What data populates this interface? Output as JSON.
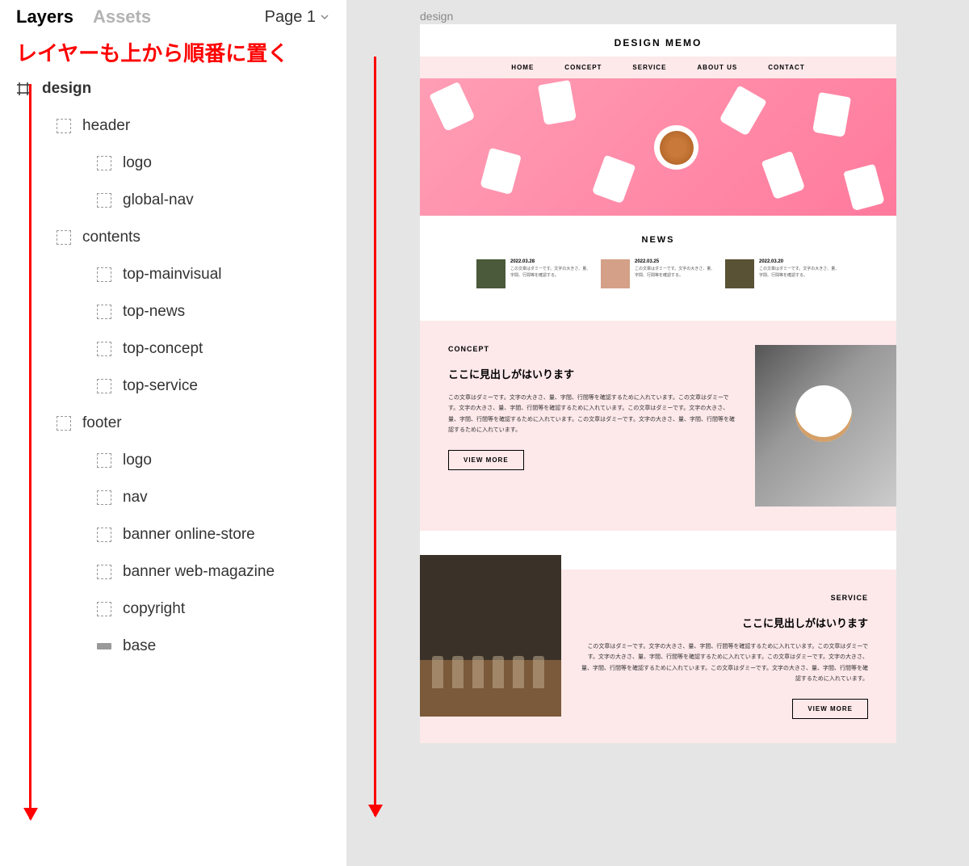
{
  "panel": {
    "tabs": {
      "layers": "Layers",
      "assets": "Assets"
    },
    "page": "Page 1",
    "annotation": "レイヤーも上から順番に置く",
    "root_frame": "design",
    "tree": {
      "header": {
        "name": "header",
        "children": [
          "logo",
          "global-nav"
        ]
      },
      "contents": {
        "name": "contents",
        "children": [
          "top-mainvisual",
          "top-news",
          "top-concept",
          "top-service"
        ]
      },
      "footer": {
        "name": "footer",
        "children": [
          "logo",
          "nav",
          "banner online-store",
          "banner web-magazine",
          "copyright",
          "base"
        ]
      }
    }
  },
  "canvas": {
    "frame_label": "design",
    "site_logo": "DESIGN MEMO",
    "nav": [
      "HOME",
      "CONCEPT",
      "SERVICE",
      "ABOUT US",
      "CONTACT"
    ],
    "news": {
      "title": "NEWS",
      "items": [
        {
          "date": "2022.03.28",
          "text": "この文章はダミーです。文字の大きさ、量、字間、行間等を確認する。"
        },
        {
          "date": "2022.03.25",
          "text": "この文章はダミーです。文字の大きさ、量、字間、行間等を確認する。"
        },
        {
          "date": "2022.03.20",
          "text": "この文章はダミーです。文字の大きさ、量、字間、行間等を確認する。"
        }
      ]
    },
    "concept": {
      "label": "CONCEPT",
      "heading": "ここに見出しがはいります",
      "body": "この文章はダミーです。文字の大きさ、量、字間、行間等を確認するために入れています。この文章はダミーです。文字の大きさ、量、字間、行間等を確認するために入れています。この文章はダミーです。文字の大きさ、量、字間、行間等を確認するために入れています。この文章はダミーです。文字の大きさ、量、字間、行間等を確認するために入れています。",
      "button": "VIEW MORE"
    },
    "service": {
      "label": "SERVICE",
      "heading": "ここに見出しがはいります",
      "body": "この文章はダミーです。文字の大きさ、量、字間、行間等を確認するために入れています。この文章はダミーです。文字の大きさ、量、字間、行間等を確認するために入れています。この文章はダミーです。文字の大きさ、量、字間、行間等を確認するために入れています。この文章はダミーです。文字の大きさ、量、字間、行間等を確認するために入れています。",
      "button": "VIEW MORE"
    }
  }
}
